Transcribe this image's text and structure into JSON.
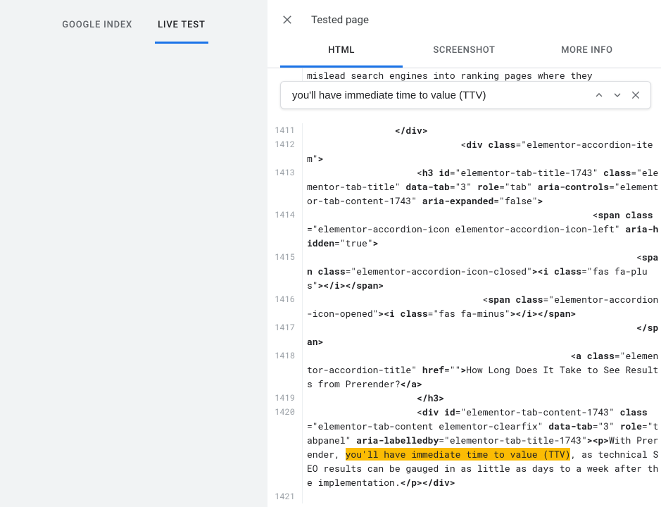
{
  "left_tabs": {
    "google_index": "GOOGLE INDEX",
    "live_test": "LIVE TEST"
  },
  "panel": {
    "title": "Tested page",
    "tabs": {
      "html": "HTML",
      "screenshot": "SCREENSHOT",
      "more_info": "MORE INFO"
    }
  },
  "search": {
    "value": "you'll have immediate time to value (TTV)"
  },
  "code": {
    "partial_top_1": "mislead search engines into ranking pages where they",
    "l1411": "                </div>",
    "l1412_pre": "                            <",
    "l1412_tag": "div",
    "l1412_attr1": " class",
    "l1412_val1": "=\"elementor-accordion-item\"",
    "l1412_close": ">",
    "l1413_pre": "                    <",
    "l1413_tag": "h3",
    "l1413_a1": " id",
    "l1413_v1": "=\"elementor-tab-title-1743\"",
    "l1413_a2": " class",
    "l1413_v2": "=\"elementor-tab-title\"",
    "l1413_a3": " data-tab",
    "l1413_v3": "=\"3\"",
    "l1413_a4": " role",
    "l1413_v4": "=\"tab\"",
    "l1413_a5": " aria-controls",
    "l1413_v5": "=\"elementor-tab-content-1743\"",
    "l1413_a6": " aria-expanded",
    "l1413_v6": "=\"false\"",
    "l1413_close": ">",
    "l1414_pre": "                                                    <",
    "l1414_tag": "span",
    "l1414_a1": " class",
    "l1414_v1": "=\"elementor-accordion-icon elementor-accordion-icon-left\"",
    "l1414_a2": " aria-hidden",
    "l1414_v2": "=\"true\"",
    "l1414_close": ">",
    "l1415_pre": "                                                            <",
    "l1415_tag": "span",
    "l1415_a1": " class",
    "l1415_v1": "=\"elementor-accordion-icon-closed\"",
    "l1415_mid": "><",
    "l1415_tag2": "i",
    "l1415_a2": " class",
    "l1415_v2": "=\"fas fa-plus\"",
    "l1415_close": "></i></span>",
    "l1416_pre": "                                <",
    "l1416_tag": "span",
    "l1416_a1": " class",
    "l1416_v1": "=\"elementor-accordion-icon-opened\"",
    "l1416_mid": "><",
    "l1416_tag2": "i",
    "l1416_a2": " class",
    "l1416_v2": "=\"fas fa-minus\"",
    "l1416_close": "></i></span>",
    "l1417": "                                                            </span>",
    "l1418_pre": "                                                <",
    "l1418_tag": "a",
    "l1418_a1": " class",
    "l1418_v1": "=\"elementor-accordion-title\"",
    "l1418_a2": " href",
    "l1418_v2": "=\"\"",
    "l1418_close": ">",
    "l1418_text": "How Long Does It Take to See Results from Prerender?",
    "l1418_end": "</a>",
    "l1419": "                    </h3>",
    "l1420_pre": "                    <",
    "l1420_tag": "div",
    "l1420_a1": " id",
    "l1420_v1": "=\"elementor-tab-content-1743\"",
    "l1420_a2": " class",
    "l1420_v2": "=\"elementor-tab-content elementor-clearfix\"",
    "l1420_a3": " data-tab",
    "l1420_v3": "=\"3\"",
    "l1420_a4": " role",
    "l1420_v4": "=\"tabpanel\"",
    "l1420_a5": " aria-labelledby",
    "l1420_v5": "=\"elementor-tab-title-1743\"",
    "l1420_close": ">",
    "l1420_p": "<p>",
    "l1420_text1": "With Prerender, ",
    "l1420_hl": "you'll have immediate time to value (TTV)",
    "l1420_text2": ", as technical SEO results can be gauged in as little as days to a week after the implementation.",
    "l1420_end": "</p></div>",
    "l1421": ""
  }
}
